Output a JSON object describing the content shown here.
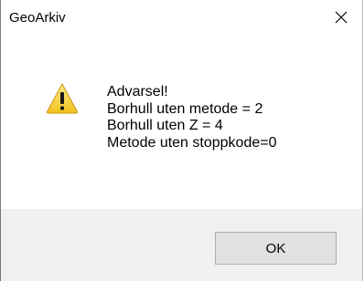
{
  "window": {
    "title": "GeoArkiv",
    "close_icon": "close-icon"
  },
  "message": {
    "icon": "warning-icon",
    "lines": [
      "Advarsel!",
      "Borhull uten metode = 2",
      "Borhull uten Z = 4",
      "Metode uten stoppkode=0"
    ]
  },
  "buttons": {
    "ok_label": "OK"
  },
  "colors": {
    "footer_background": "#f0f0f0",
    "button_face": "#e1e1e1",
    "warning_yellow": "#f7d23a"
  }
}
